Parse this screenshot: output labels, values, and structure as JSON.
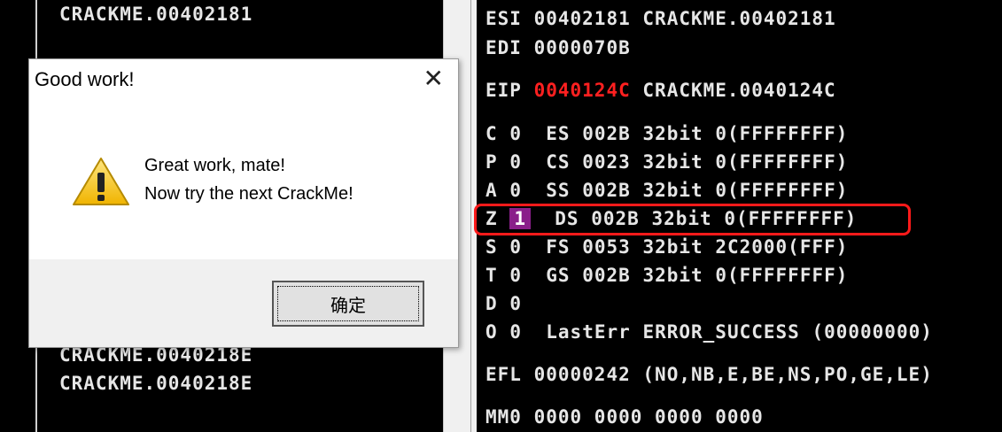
{
  "left_pane": {
    "lines": [
      "CRACKME.00402181",
      "CRACKME.0040218E",
      "CRACKME.0040218E"
    ]
  },
  "registers": {
    "esi": {
      "name": "ESI",
      "value": "00402181",
      "comment": "CRACKME.00402181"
    },
    "edi": {
      "name": "EDI",
      "value": "0000070B"
    },
    "eip": {
      "name": "EIP",
      "value": "0040124C",
      "comment": "CRACKME.0040124C"
    },
    "flags": [
      {
        "flag": "C",
        "val": "0",
        "seg": "ES",
        "sel": "002B",
        "bits": "32bit",
        "desc": "0(FFFFFFFF)"
      },
      {
        "flag": "P",
        "val": "0",
        "seg": "CS",
        "sel": "0023",
        "bits": "32bit",
        "desc": "0(FFFFFFFF)"
      },
      {
        "flag": "A",
        "val": "0",
        "seg": "SS",
        "sel": "002B",
        "bits": "32bit",
        "desc": "0(FFFFFFFF)"
      },
      {
        "flag": "Z",
        "val": "1",
        "seg": "DS",
        "sel": "002B",
        "bits": "32bit",
        "desc": "0(FFFFFFFF)"
      },
      {
        "flag": "S",
        "val": "0",
        "seg": "FS",
        "sel": "0053",
        "bits": "32bit",
        "desc": "2C2000(FFF)"
      },
      {
        "flag": "T",
        "val": "0",
        "seg": "GS",
        "sel": "002B",
        "bits": "32bit",
        "desc": "0(FFFFFFFF)"
      },
      {
        "flag": "D",
        "val": "0"
      },
      {
        "flag": "O",
        "val": "0",
        "lasterr_label": "LastErr",
        "lasterr": "ERROR_SUCCESS (00000000)"
      }
    ],
    "efl": {
      "name": "EFL",
      "value": "00000242",
      "desc": "(NO,NB,E,BE,NS,PO,GE,LE)"
    },
    "mm0": {
      "name": "MM0",
      "value": "0000 0000 0000 0000"
    }
  },
  "dialog": {
    "title": "Good work!",
    "close_glyph": "✕",
    "icon": "warning-icon",
    "message_line1": "Great work, mate!",
    "message_line2": "Now try the next CrackMe!",
    "ok_label": "确定"
  },
  "colors": {
    "highlight": "#ff1a1a",
    "changed_value": "#ff2020",
    "zero_flag_bg": "#8a1f8a"
  }
}
